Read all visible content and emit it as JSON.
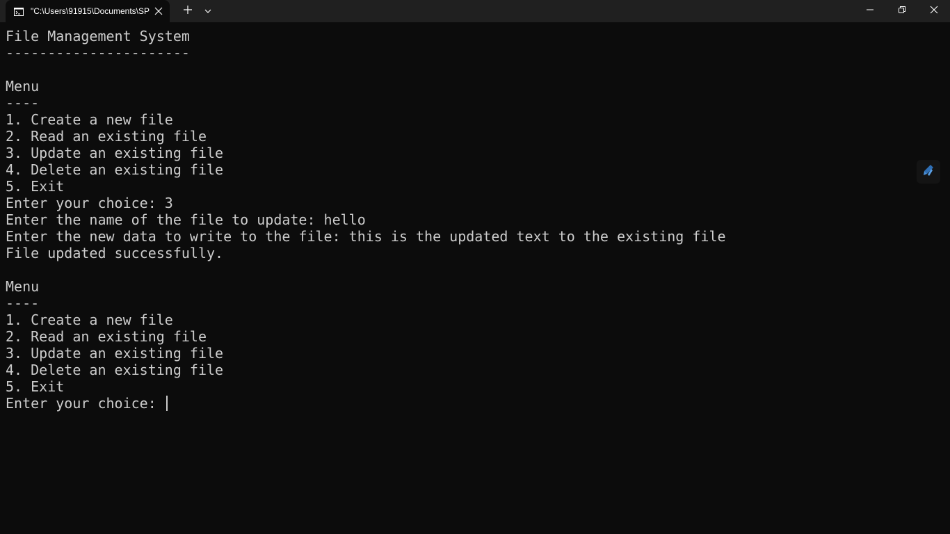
{
  "window": {
    "tab_title": "\"C:\\Users\\91915\\Documents\\SP",
    "icons": {
      "tab": "cmd-terminal-icon",
      "tab_close": "close-icon",
      "new_tab": "plus-icon",
      "tab_dropdown": "chevron-down-icon",
      "minimize": "minimize-icon",
      "maximize": "restore-icon",
      "close": "close-icon",
      "side": "pen-icon"
    }
  },
  "console": {
    "lines": [
      "File Management System",
      "----------------------",
      "",
      "Menu",
      "----",
      "1. Create a new file",
      "2. Read an existing file",
      "3. Update an existing file",
      "4. Delete an existing file",
      "5. Exit",
      "Enter your choice: 3",
      "Enter the name of the file to update: hello",
      "Enter the new data to write to the file: this is the updated text to the existing file",
      "File updated successfully.",
      "",
      "Menu",
      "----",
      "1. Create a new file",
      "2. Read an existing file",
      "3. Update an existing file",
      "4. Delete an existing file",
      "5. Exit"
    ],
    "prompt": "Enter your choice: "
  },
  "colors": {
    "background": "#0c0c0c",
    "titlebar": "#202020",
    "text": "#cccccc",
    "accent_icon": "#4a90d9"
  }
}
